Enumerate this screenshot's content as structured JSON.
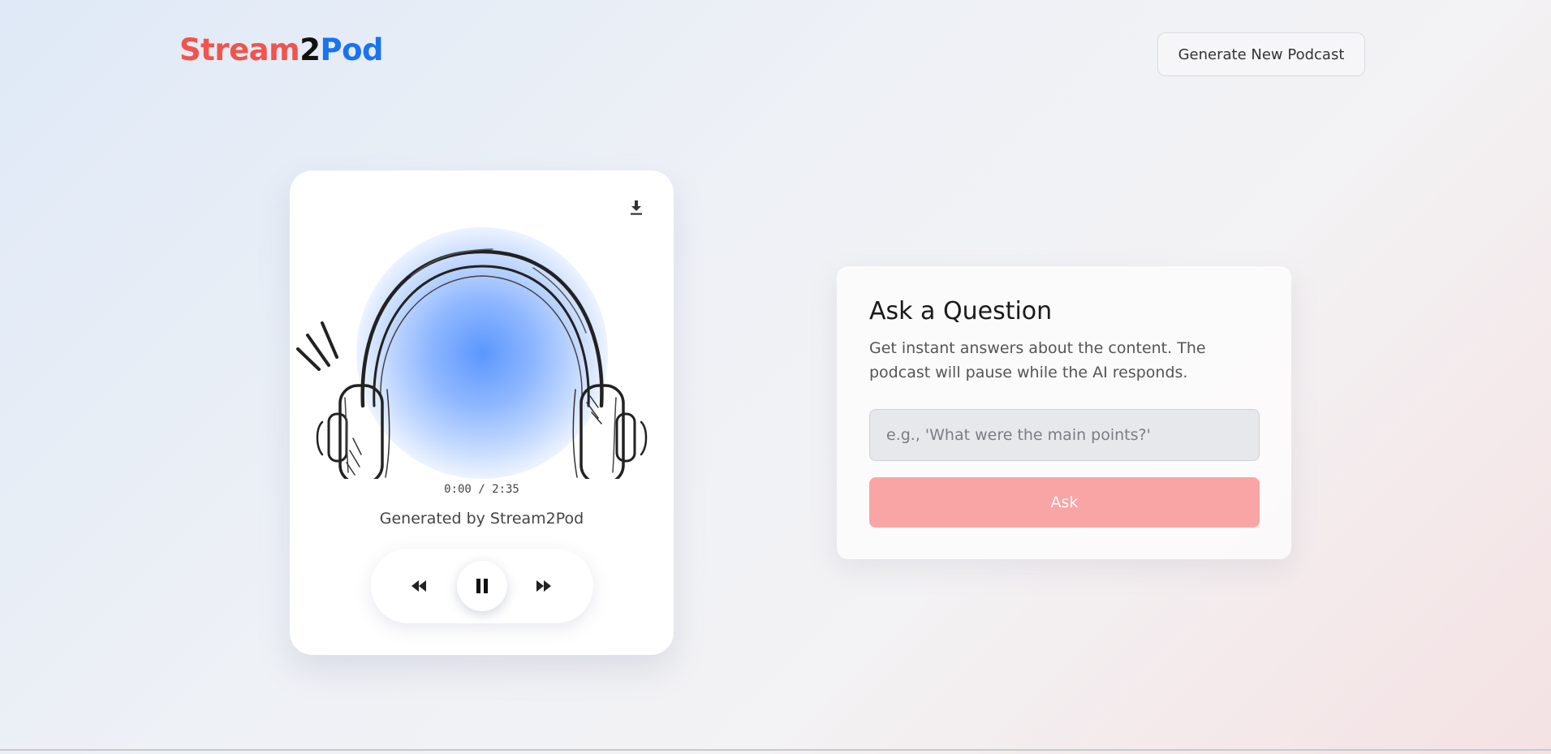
{
  "brand": {
    "part1": "Stream",
    "part2": "2",
    "part3": "Pod",
    "colors": {
      "part1": "#f0544d",
      "part2": "#111111",
      "part3": "#1a73f0"
    }
  },
  "header": {
    "generate_button_label": "Generate New Podcast"
  },
  "player": {
    "download_icon": "download-icon",
    "artwork_icon": "headphones-icon",
    "time_display": "0:00 / 2:35",
    "caption": "Generated by Stream2Pod",
    "controls": {
      "rewind_icon": "rewind-icon",
      "pause_icon": "pause-icon",
      "forward_icon": "fast-forward-icon"
    },
    "glow_color": "#5b97ff"
  },
  "qa": {
    "title": "Ask a Question",
    "description": "Get instant answers about the content. The podcast will pause while the AI responds.",
    "input_placeholder": "e.g., 'What were the main points?'",
    "input_value": "",
    "ask_label": "Ask",
    "ask_color": "#f9a5a5"
  }
}
